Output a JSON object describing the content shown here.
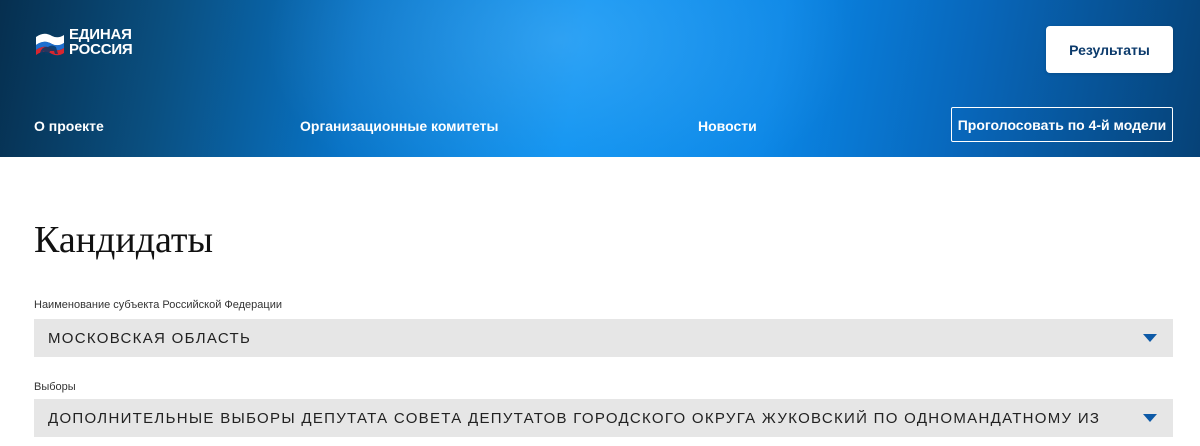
{
  "header": {
    "logo": {
      "line1": "ЕДИНАЯ",
      "line2": "РОССИЯ",
      "icon": "bear-flag-icon"
    },
    "results_label": "Результаты",
    "nav": {
      "about": "О проекте",
      "committees": "Организационные комитеты",
      "news": "Новости"
    },
    "vote_label": "Проголосовать по 4-й модели"
  },
  "main": {
    "title": "Кандидаты",
    "subject_field": {
      "label": "Наименование субъекта Российской Федерации",
      "value": "Московская область"
    },
    "elections_field": {
      "label": "Выборы",
      "value": "Дополнительные выборы депутата Совета депутатов городского округа Жуковский по одномандатному из"
    }
  },
  "colors": {
    "header_dark": "#062f4f",
    "header_bright": "#078ff0",
    "caret": "#0d5aa7",
    "select_bg": "#e6e6e6",
    "button_text": "#0b3a6b"
  }
}
